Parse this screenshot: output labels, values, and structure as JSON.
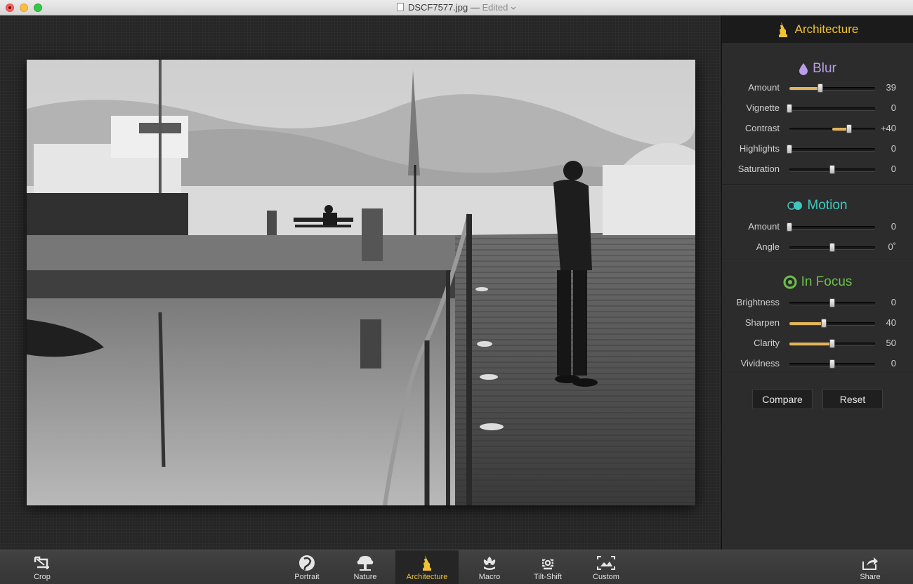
{
  "window": {
    "filename": "DSCF7577.jpg",
    "separator": "—",
    "status": "Edited",
    "status_icon": "chevron-down-icon"
  },
  "colors": {
    "accent": "#f1c232",
    "blur": "#b89ee8",
    "motion": "#3ec9c0",
    "in_focus": "#6cc04a",
    "slider_fill": "#e2b45b"
  },
  "panel": {
    "title": "Architecture",
    "title_icon": "statue-of-liberty-icon",
    "sections": [
      {
        "name": "Blur",
        "icon": "drop-icon",
        "sliders": [
          {
            "label": "Amount",
            "value": "39",
            "level": 0.36,
            "center": false
          },
          {
            "label": "Vignette",
            "value": "0",
            "level": 0.0,
            "center": false
          },
          {
            "label": "Contrast",
            "value": "+40",
            "level": 0.7,
            "center": true
          },
          {
            "label": "Highlights",
            "value": "0",
            "level": 0.0,
            "center": false
          },
          {
            "label": "Saturation",
            "value": "0",
            "level": 0.5,
            "center": true
          }
        ]
      },
      {
        "name": "Motion",
        "icon": "motion-icon",
        "sliders": [
          {
            "label": "Amount",
            "value": "0",
            "level": 0.0,
            "center": false
          },
          {
            "label": "Angle",
            "value": "0˚",
            "level": 0.5,
            "center": true
          }
        ]
      },
      {
        "name": "In Focus",
        "icon": "focus-icon",
        "sliders": [
          {
            "label": "Brightness",
            "value": "0",
            "level": 0.5,
            "center": true
          },
          {
            "label": "Sharpen",
            "value": "40",
            "level": 0.4,
            "center": false
          },
          {
            "label": "Clarity",
            "value": "50",
            "level": 0.5,
            "center": false
          },
          {
            "label": "Vividness",
            "value": "0",
            "level": 0.5,
            "center": true
          }
        ]
      }
    ],
    "compare_label": "Compare",
    "reset_label": "Reset"
  },
  "toolbar": {
    "crop": "Crop",
    "portrait": "Portrait",
    "nature": "Nature",
    "architecture": "Architecture",
    "macro": "Macro",
    "tilt_shift": "Tilt-Shift",
    "custom": "Custom",
    "share": "Share",
    "active": "Architecture"
  }
}
